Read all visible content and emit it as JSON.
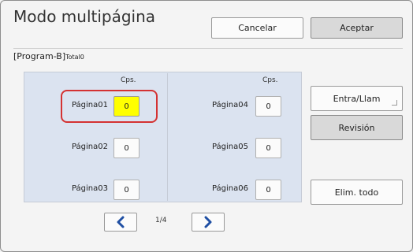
{
  "header": {
    "title": "Modo multipágina",
    "cancel_label": "Cancelar",
    "accept_label": "Aceptar"
  },
  "program": {
    "name": "[Program-B]",
    "total_label": "Total0"
  },
  "columns": {
    "left_header": "Cps.",
    "right_header": "Cps."
  },
  "pages": [
    {
      "label": "Página01",
      "copies": "0",
      "selected": true
    },
    {
      "label": "Página02",
      "copies": "0",
      "selected": false
    },
    {
      "label": "Página03",
      "copies": "0",
      "selected": false
    },
    {
      "label": "Página04",
      "copies": "0",
      "selected": false
    },
    {
      "label": "Página05",
      "copies": "0",
      "selected": false
    },
    {
      "label": "Página06",
      "copies": "0",
      "selected": false
    }
  ],
  "actions": {
    "entry_label": "Entra/Llam",
    "review_label": "Revisión",
    "clear_all_label": "Elim. todo"
  },
  "pagination": {
    "indicator": "1/4",
    "prev_icon": "chevron-left-icon",
    "next_icon": "chevron-right-icon"
  },
  "colors": {
    "selected_fill": "#ffff00",
    "selection_outline": "#d43232",
    "panel_bg": "#dbe3f0",
    "nav_arrow": "#1f4fa3"
  }
}
